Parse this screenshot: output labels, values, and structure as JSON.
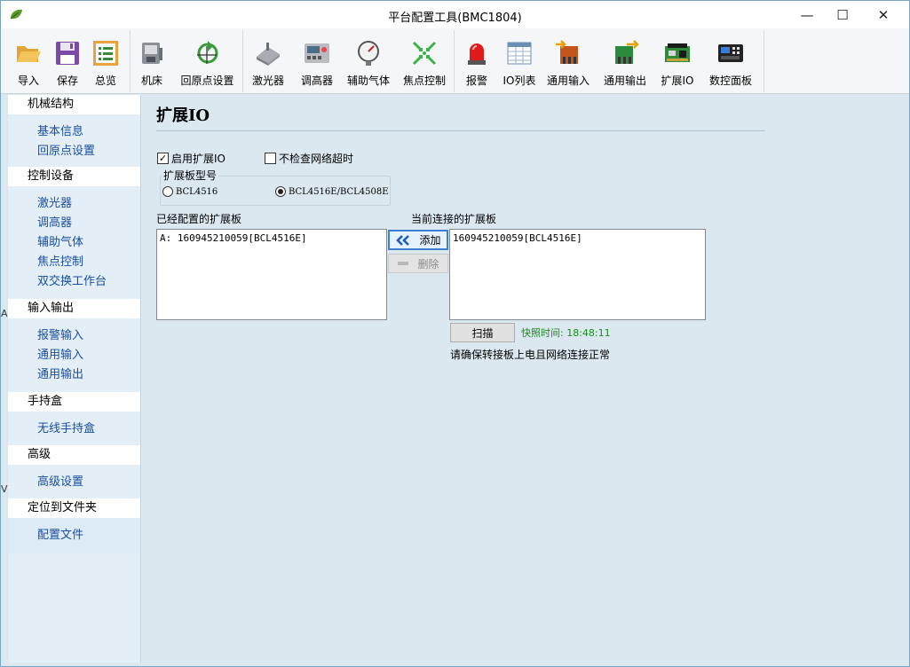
{
  "window": {
    "title": "平台配置工具(BMC1804)",
    "minimize": "—",
    "maximize": "☐",
    "close": "✕"
  },
  "toolbar": {
    "groups": [
      [
        {
          "label": "导入",
          "icon": "folder-open-icon"
        },
        {
          "label": "保存",
          "icon": "floppy-save-icon"
        },
        {
          "label": "总览",
          "icon": "overview-list-icon"
        }
      ],
      [
        {
          "label": "机床",
          "icon": "machine-icon"
        },
        {
          "label": "回原点设置",
          "icon": "return-origin-icon"
        }
      ],
      [
        {
          "label": "激光器",
          "icon": "laser-icon"
        },
        {
          "label": "调高器",
          "icon": "height-controller-icon"
        },
        {
          "label": "辅助气体",
          "icon": "pressure-gauge-icon"
        },
        {
          "label": "焦点控制",
          "icon": "focus-control-icon"
        }
      ],
      [
        {
          "label": "报警",
          "icon": "alarm-light-icon"
        },
        {
          "label": "IO列表",
          "icon": "io-table-icon"
        },
        {
          "label": "通用输入",
          "icon": "general-input-icon"
        },
        {
          "label": "通用输出",
          "icon": "general-output-icon"
        },
        {
          "label": "扩展IO",
          "icon": "expansion-board-icon"
        },
        {
          "label": "数控面板",
          "icon": "cnc-panel-icon"
        }
      ]
    ]
  },
  "sidebar": {
    "sections": [
      {
        "header": "机械结构",
        "items": [
          "基本信息",
          "回原点设置"
        ]
      },
      {
        "header": "控制设备",
        "items": [
          "激光器",
          "调高器",
          "辅助气体",
          "焦点控制",
          "双交换工作台"
        ]
      },
      {
        "header": "输入输出",
        "items": [
          "报警输入",
          "通用输入",
          "通用输出"
        ]
      },
      {
        "header": "手持盒",
        "items": [
          "无线手持盒"
        ]
      },
      {
        "header": "高级",
        "items": [
          "高级设置"
        ]
      },
      {
        "header": "定位到文件夹",
        "items": [
          "配置文件"
        ]
      }
    ],
    "edge_chars": [
      "A",
      "V"
    ]
  },
  "main": {
    "title": "扩展IO",
    "enable_expand": {
      "label": "启用扩展IO",
      "checked": true,
      "mark": "✓"
    },
    "skip_timeout": {
      "label": "不检查网络超时",
      "checked": false
    },
    "board_type": {
      "title": "扩展板型号",
      "options": [
        "BCL4516",
        "BCL4516E/BCL4508E"
      ],
      "selected": 1
    },
    "configured": {
      "label": "已经配置的扩展板",
      "items": [
        "A: 160945210059[BCL4516E]"
      ]
    },
    "connected": {
      "label": "当前连接的扩展板",
      "items": [
        "160945210059[BCL4516E]"
      ]
    },
    "add_button": "添加",
    "delete_button": "删除",
    "scan_button": "扫描",
    "snapshot": "快照时间: 18:48:11",
    "hint": "请确保转接板上电且网络连接正常"
  }
}
